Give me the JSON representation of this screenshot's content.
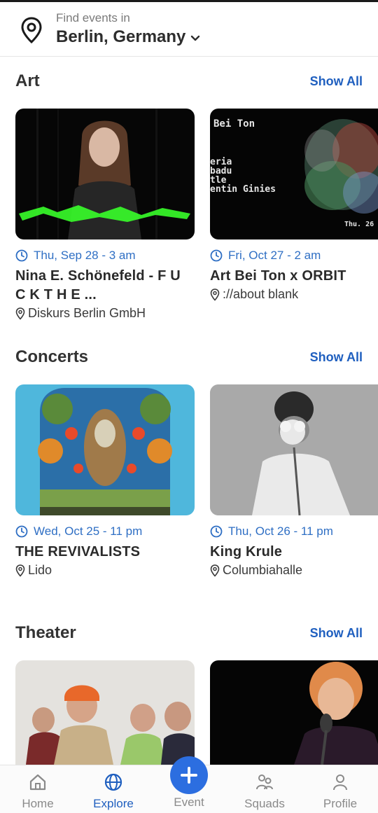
{
  "header": {
    "find_label": "Find events in",
    "city": "Berlin, Germany"
  },
  "sections": [
    {
      "title": "Art",
      "show_all": "Show All",
      "events": [
        {
          "date": "Thu, Sep 28 - 3 am",
          "title": "Nina E. Schönefeld - F U C K T H E ...",
          "venue": "Diskurs Berlin GmbH"
        },
        {
          "date": "Fri, Oct 27 - 2 am",
          "title": "Art Bei Ton x ORBIT",
          "venue": "://about blank",
          "poster_text": [
            "Bei Ton",
            "eria",
            "badu",
            "tle",
            "entin Ginies",
            "Thu. 26"
          ]
        }
      ]
    },
    {
      "title": "Concerts",
      "show_all": "Show All",
      "events": [
        {
          "date": "Wed, Oct 25 - 11 pm",
          "title": "THE REVIVALISTS",
          "venue": "Lido"
        },
        {
          "date": "Thu, Oct 26 - 11 pm",
          "title": "King Krule",
          "venue": "Columbiahalle"
        }
      ]
    },
    {
      "title": "Theater",
      "show_all": "Show All",
      "events": []
    }
  ],
  "nav": {
    "home": "Home",
    "explore": "Explore",
    "event": "Event",
    "squads": "Squads",
    "profile": "Profile",
    "active": "explore"
  },
  "colors": {
    "accent": "#1f5fbf",
    "fab": "#2c6ee0"
  }
}
